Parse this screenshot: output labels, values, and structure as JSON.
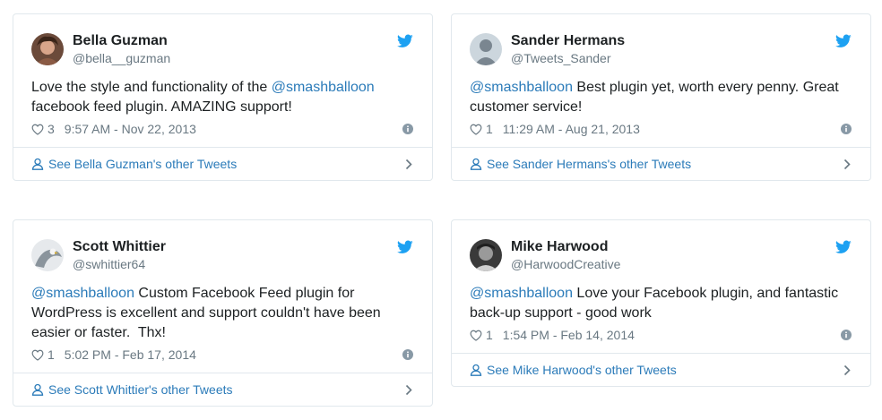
{
  "colors": {
    "link": "#2b7bb9",
    "twitter_blue": "#1da1f2",
    "muted": "#697882",
    "border": "#e1e8ed"
  },
  "tweets": [
    {
      "display_name": "Bella Guzman",
      "handle": "@bella__guzman",
      "text_mention": "",
      "text_before": "Love the style and functionality of the ",
      "mention_inline": "@smashballoon",
      "text_after": "\nfacebook feed plugin. AMAZING support!",
      "likes": "3",
      "timestamp": "9:57 AM - Nov 22, 2013",
      "footer": "See Bella Guzman's other Tweets",
      "avatar_icon": "photo-avatar-icon"
    },
    {
      "display_name": "Sander Hermans",
      "handle": "@Tweets_Sander",
      "text_mention": "@smashballoon",
      "text_before": "",
      "mention_inline": "",
      "text_after": " Best plugin yet, worth every penny. Great\ncustomer service!",
      "likes": "1",
      "timestamp": "11:29 AM - Aug 21, 2013",
      "footer": "See Sander Hermans's other Tweets",
      "avatar_icon": "default-avatar-icon"
    },
    {
      "display_name": "Scott Whittier",
      "handle": "@swhittier64",
      "text_mention": "@smashballoon",
      "text_before": "",
      "mention_inline": "",
      "text_after": " Custom Facebook Feed plugin for\nWordPress is excellent and support couldn't have been\neasier or faster.  Thx!",
      "likes": "1",
      "timestamp": "5:02 PM - Feb 17, 2014",
      "footer": "See Scott Whittier's other Tweets",
      "avatar_icon": "eagle-avatar-icon"
    },
    {
      "display_name": "Mike Harwood",
      "handle": "@HarwoodCreative",
      "text_mention": "@smashballoon",
      "text_before": "",
      "mention_inline": "",
      "text_after": " Love your Facebook plugin, and fantastic\nback-up support - good work",
      "likes": "1",
      "timestamp": "1:54 PM - Feb 14, 2014",
      "footer": "See Mike Harwood's other Tweets",
      "avatar_icon": "photo-avatar-icon"
    }
  ]
}
